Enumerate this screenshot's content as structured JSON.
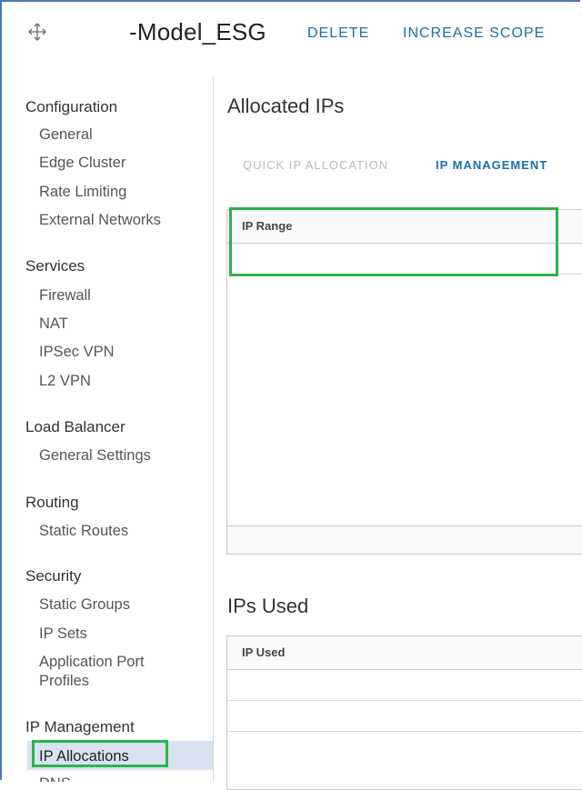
{
  "header": {
    "title": "-Model_ESG",
    "delete_label": "DELETE",
    "increase_scope_label": "INCREASE SCOPE",
    "icon": "move-arrows-icon"
  },
  "sidebar": {
    "sections": [
      {
        "title": "Configuration",
        "items": [
          "General",
          "Edge Cluster",
          "Rate Limiting",
          "External Networks"
        ]
      },
      {
        "title": "Services",
        "items": [
          "Firewall",
          "NAT",
          "IPSec VPN",
          "L2 VPN"
        ]
      },
      {
        "title": "Load Balancer",
        "items": [
          "General Settings"
        ]
      },
      {
        "title": "Routing",
        "items": [
          "Static Routes"
        ]
      },
      {
        "title": "Security",
        "items": [
          "Static Groups",
          "IP Sets",
          "Application Port Profiles"
        ]
      },
      {
        "title": "IP Management",
        "items": [
          "IP Allocations",
          "DNS"
        ]
      }
    ],
    "active_item": "IP Allocations"
  },
  "main": {
    "allocated_heading": "Allocated IPs",
    "tabs": [
      {
        "label": "QUICK IP ALLOCATION",
        "active": false
      },
      {
        "label": "IP MANAGEMENT",
        "active": true
      }
    ],
    "allocated_grid": {
      "columns": [
        "IP Range"
      ]
    },
    "used_heading": "IPs Used",
    "used_grid": {
      "columns": [
        "IP Used"
      ]
    }
  },
  "colors": {
    "accent_blue": "#1b6fa8",
    "highlight_green": "#2db34a",
    "frame_blue": "#4a78b8",
    "active_bg": "#d8e3ef"
  }
}
